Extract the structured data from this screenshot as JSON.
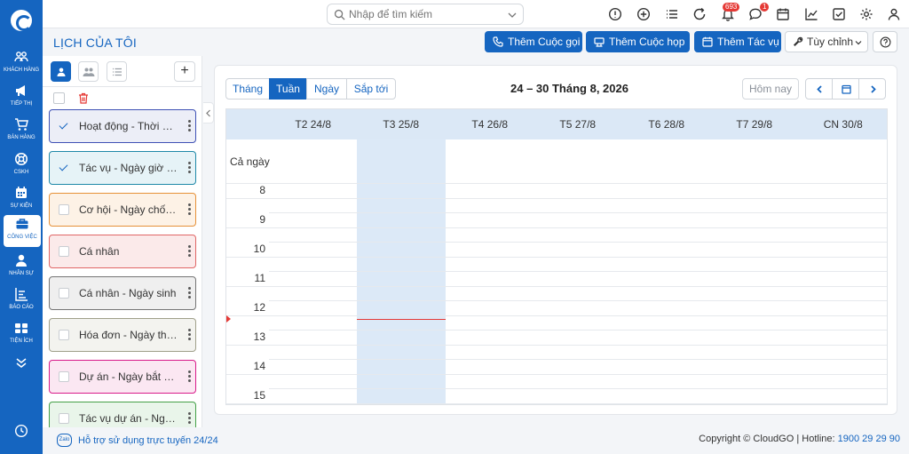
{
  "topbar": {
    "search_placeholder": "Nhập để tìm kiếm",
    "notifications_badge": "693",
    "messages_badge": "1"
  },
  "leftnav": {
    "items": [
      {
        "label": "Khách hàng",
        "icon": "users-icon"
      },
      {
        "label": "Tiếp thị",
        "icon": "megaphone-icon"
      },
      {
        "label": "Bán hàng",
        "icon": "cart-icon"
      },
      {
        "label": "CSKH",
        "icon": "lifebuoy-icon"
      },
      {
        "label": "Sự kiện",
        "icon": "calendar-icon"
      },
      {
        "label": "Công việc",
        "icon": "briefcase-icon"
      },
      {
        "label": "Nhân sự",
        "icon": "person-icon"
      },
      {
        "label": "Báo cáo",
        "icon": "report-icon"
      },
      {
        "label": "Tiện ích",
        "icon": "utilities-icon"
      }
    ],
    "active_index": 5
  },
  "header": {
    "title": "LỊCH CỦA TÔI",
    "add_call": "Thêm Cuộc gọi",
    "add_meeting": "Thêm Cuộc họp",
    "add_task": "Thêm Tác vụ",
    "customize": "Tùy chỉnh"
  },
  "sidepanel": {
    "calendars": [
      {
        "name": "Hoạt động - Thời gian",
        "checked": true,
        "color": "#3f51b5",
        "bg": "#eceef7"
      },
      {
        "name": "Tác vụ - Ngày giờ bắt đầu",
        "checked": true,
        "color": "#1e88a8",
        "bg": "#e6f3f7"
      },
      {
        "name": "Cơ hội - Ngày chốt dự kiến",
        "checked": false,
        "color": "#e69138",
        "bg": "#fdf2e6"
      },
      {
        "name": "Cá nhân",
        "checked": false,
        "color": "#e06666",
        "bg": "#fbeaea"
      },
      {
        "name": "Cá nhân - Ngày sinh",
        "checked": false,
        "color": "#757575",
        "bg": "#efefef"
      },
      {
        "name": "Hóa đơn - Ngày thu tiền",
        "checked": false,
        "color": "#a0a08a",
        "bg": "#f3f3ef"
      },
      {
        "name": "Dự án - Ngày bắt đầu",
        "checked": false,
        "color": "#d81b8a",
        "bg": "#fbe7f2"
      },
      {
        "name": "Tác vụ dự án - Ngày bắt đầu",
        "checked": false,
        "color": "#43a047",
        "bg": "#e9f5ea"
      }
    ]
  },
  "calendar": {
    "views": [
      "Tháng",
      "Tuần",
      "Ngày",
      "Sắp tới"
    ],
    "active_view": "Tuần",
    "range_title": "24 – 30 Tháng 8, 2026",
    "today_label": "Hôm nay",
    "days": [
      "T2 24/8",
      "T3 25/8",
      "T4 26/8",
      "T5 27/8",
      "T6 28/8",
      "T7 29/8",
      "CN 30/8"
    ],
    "today_column": "T3 25/8",
    "allday_label": "Cả ngày",
    "hours": [
      "8",
      "9",
      "10",
      "11",
      "12",
      "13",
      "14",
      "15"
    ]
  },
  "footer": {
    "zalo": "Zalo",
    "support": "Hỗ trợ sử dụng trực tuyến 24/24",
    "copyright": "Copyright © CloudGO",
    "hotline_label": "| Hotline:",
    "hotline": "1900 29 29 90"
  }
}
